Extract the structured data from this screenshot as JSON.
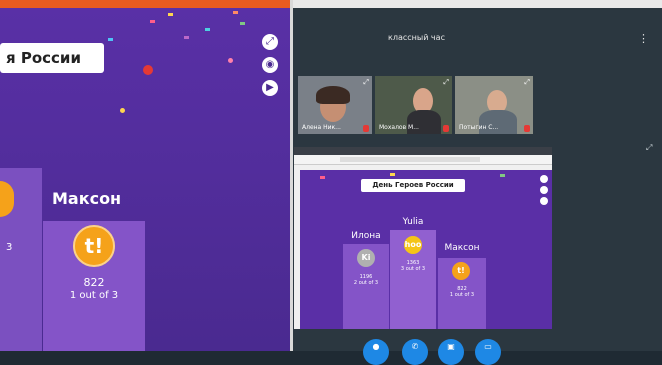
{
  "left_panel": {
    "banner_title": "я России",
    "player_name": "Максон",
    "badge_text": "t!",
    "score": "822",
    "rank_text": "1 out of 3",
    "left_partial_rank": "3"
  },
  "meeting": {
    "title": "классный час",
    "participants": [
      {
        "label": "Алена Ник..."
      },
      {
        "label": "Мохалов М..."
      },
      {
        "label": "Потыгин С..."
      }
    ]
  },
  "shared_screen": {
    "banner_title": "День Героев России",
    "podium": [
      {
        "name": "Илона",
        "badge": "Ki",
        "score": "1196",
        "rank_text": "2 out of 3"
      },
      {
        "name": "Yulia",
        "badge": "hoo",
        "score": "1363",
        "rank_text": "3 out of 3"
      },
      {
        "name": "Максон",
        "badge": "t!",
        "score": "822",
        "rank_text": "1 out of 3"
      }
    ]
  },
  "colors": {
    "accent": "#e85b1f",
    "stage_purple": "#5a2fa6",
    "podium_purple": "#8454c8",
    "badge_orange": "#f5a21a",
    "control_blue": "#1e88e5"
  },
  "icons": {
    "fullscreen": "expand-icon",
    "sound": "speaker-icon",
    "skip": "skip-icon",
    "more": "more-vertical-icon",
    "mic": "microphone-icon",
    "phone": "phone-icon",
    "camera": "camera-icon",
    "screen": "screen-share-icon"
  }
}
